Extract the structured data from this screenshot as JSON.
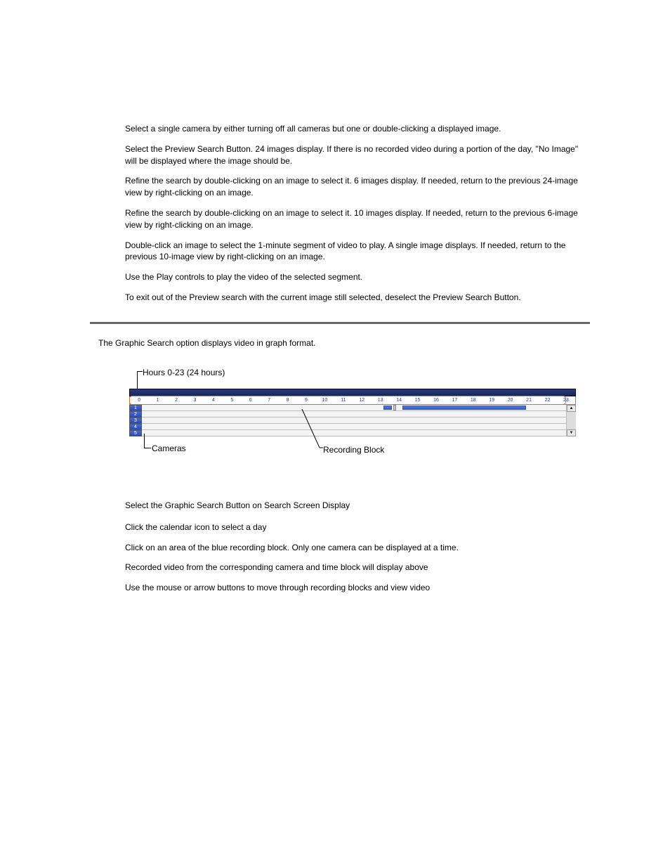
{
  "preview_paragraphs": [
    "Select a single camera by either turning off all cameras but one or double-clicking a displayed image.",
    "Select the Preview Search Button.  24 images display.  If there is no recorded video during a portion of the day, \"No Image\" will be displayed where the image should be.",
    "Refine the search by double-clicking on an image to select it.  6 images display. If needed, return to the previous 24-image view by right-clicking on an image.",
    "Refine the search by double-clicking on an image to select it.  10 images display. If needed, return to the previous 6-image view by right-clicking on an image.",
    "Double-click an image to select the 1-minute segment of video to play.  A single image displays.  If needed, return to the previous 10-image view by right-clicking on an image.",
    "Use the Play controls to play the video of the selected segment.",
    "To exit out of the Preview search with the current image still selected, deselect the Preview Search Button."
  ],
  "graphic_intro": "The Graphic Search option displays video in graph format.",
  "annotations": {
    "hours": "Hours 0-23 (24 hours)",
    "cameras": "Cameras",
    "recording_block": "Recording Block"
  },
  "graph": {
    "hours": [
      "0",
      "1",
      "2",
      "3",
      "4",
      "5",
      "6",
      "7",
      "8",
      "9",
      "10",
      "11",
      "12",
      "13",
      "14",
      "15",
      "16",
      "17",
      "18",
      "19",
      "20",
      "21",
      "22",
      "23"
    ],
    "cameras": [
      "1",
      "2",
      "3",
      "4",
      "5"
    ],
    "recording_blocks": [
      {
        "camera_index": 0,
        "left_pct": 57.0,
        "width_pct": 2.0,
        "marker": true
      },
      {
        "camera_index": 0,
        "left_pct": 61.5,
        "width_pct": 29.0,
        "marker": false
      }
    ]
  },
  "steps_title": "Select the Graphic Search Button on Search Screen Display",
  "steps": [
    "Click the calendar icon to select a day",
    "Click on an area of the blue recording block. Only one camera can be displayed at a time.",
    "Recorded video from the corresponding camera and time block will display above",
    "Use the mouse or arrow buttons to move through recording blocks and view video"
  ]
}
